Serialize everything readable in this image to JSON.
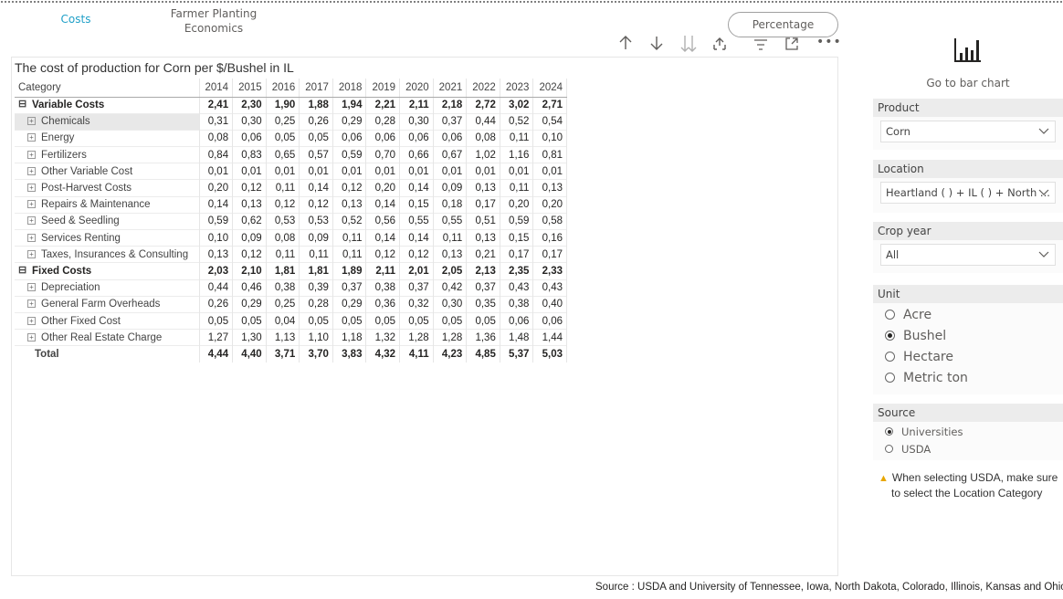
{
  "nav": {
    "costs_label": "Costs",
    "farmer_label_line1": "Farmer Planting",
    "farmer_label_line2": "Economics",
    "percentage_button": "Percentage"
  },
  "toolbar": {
    "icons": [
      "arrow-up-icon",
      "arrow-down-icon",
      "double-arrow-down-icon",
      "expand-hierarchy-icon",
      "filter-icon",
      "focus-mode-icon",
      "more-options-icon"
    ]
  },
  "matrix": {
    "title": "The cost of production for Corn per $/Bushel in IL",
    "category_header": "Category",
    "years": [
      "2014",
      "2015",
      "2016",
      "2017",
      "2018",
      "2019",
      "2020",
      "2021",
      "2022",
      "2023",
      "2024"
    ],
    "rows": [
      {
        "label": "Variable Costs",
        "level": "group",
        "values": [
          "2,41",
          "2,30",
          "1,90",
          "1,88",
          "1,94",
          "2,21",
          "2,11",
          "2,18",
          "2,72",
          "3,02",
          "2,71"
        ]
      },
      {
        "label": "Chemicals",
        "level": "child",
        "values": [
          "0,31",
          "0,30",
          "0,25",
          "0,26",
          "0,29",
          "0,28",
          "0,30",
          "0,37",
          "0,44",
          "0,52",
          "0,54"
        ]
      },
      {
        "label": "Energy",
        "level": "child",
        "values": [
          "0,08",
          "0,06",
          "0,05",
          "0,05",
          "0,06",
          "0,06",
          "0,06",
          "0,06",
          "0,08",
          "0,11",
          "0,10"
        ]
      },
      {
        "label": "Fertilizers",
        "level": "child",
        "values": [
          "0,84",
          "0,83",
          "0,65",
          "0,57",
          "0,59",
          "0,70",
          "0,66",
          "0,67",
          "1,02",
          "1,16",
          "0,81"
        ]
      },
      {
        "label": "Other Variable Cost",
        "level": "child",
        "values": [
          "0,01",
          "0,01",
          "0,01",
          "0,01",
          "0,01",
          "0,01",
          "0,01",
          "0,01",
          "0,01",
          "0,01",
          "0,01"
        ]
      },
      {
        "label": "Post-Harvest Costs",
        "level": "child",
        "values": [
          "0,20",
          "0,12",
          "0,11",
          "0,14",
          "0,12",
          "0,20",
          "0,14",
          "0,09",
          "0,13",
          "0,11",
          "0,13"
        ]
      },
      {
        "label": "Repairs & Maintenance",
        "level": "child",
        "values": [
          "0,14",
          "0,13",
          "0,12",
          "0,12",
          "0,13",
          "0,14",
          "0,15",
          "0,18",
          "0,17",
          "0,20",
          "0,20"
        ]
      },
      {
        "label": "Seed & Seedling",
        "level": "child",
        "values": [
          "0,59",
          "0,62",
          "0,53",
          "0,53",
          "0,52",
          "0,56",
          "0,55",
          "0,55",
          "0,51",
          "0,59",
          "0,58"
        ]
      },
      {
        "label": "Services Renting",
        "level": "child",
        "values": [
          "0,10",
          "0,09",
          "0,08",
          "0,09",
          "0,11",
          "0,14",
          "0,14",
          "0,11",
          "0,13",
          "0,15",
          "0,16"
        ]
      },
      {
        "label": "Taxes, Insurances & Consulting",
        "level": "child",
        "values": [
          "0,13",
          "0,12",
          "0,11",
          "0,11",
          "0,11",
          "0,12",
          "0,12",
          "0,13",
          "0,21",
          "0,17",
          "0,17"
        ]
      },
      {
        "label": "Fixed Costs",
        "level": "group",
        "values": [
          "2,03",
          "2,10",
          "1,81",
          "1,81",
          "1,89",
          "2,11",
          "2,01",
          "2,05",
          "2,13",
          "2,35",
          "2,33"
        ]
      },
      {
        "label": "Depreciation",
        "level": "child",
        "values": [
          "0,44",
          "0,46",
          "0,38",
          "0,39",
          "0,37",
          "0,38",
          "0,37",
          "0,42",
          "0,37",
          "0,43",
          "0,43"
        ]
      },
      {
        "label": "General Farm Overheads",
        "level": "child",
        "values": [
          "0,26",
          "0,29",
          "0,25",
          "0,28",
          "0,29",
          "0,36",
          "0,32",
          "0,30",
          "0,35",
          "0,38",
          "0,40"
        ]
      },
      {
        "label": "Other Fixed Cost",
        "level": "child",
        "values": [
          "0,05",
          "0,05",
          "0,04",
          "0,05",
          "0,05",
          "0,05",
          "0,05",
          "0,05",
          "0,05",
          "0,06",
          "0,06"
        ]
      },
      {
        "label": "Other Real Estate Charge",
        "level": "child",
        "values": [
          "1,27",
          "1,30",
          "1,13",
          "1,10",
          "1,18",
          "1,32",
          "1,28",
          "1,28",
          "1,36",
          "1,48",
          "1,44"
        ]
      },
      {
        "label": "Total",
        "level": "total",
        "values": [
          "4,44",
          "4,40",
          "3,71",
          "3,70",
          "3,83",
          "4,32",
          "4,11",
          "4,23",
          "4,85",
          "5,37",
          "5,03"
        ]
      }
    ],
    "selected_row": "Chemicals"
  },
  "goto_bar": {
    "label": "Go to bar chart",
    "icon": "bar-chart-icon"
  },
  "slicers": {
    "product": {
      "title": "Product",
      "value": "Corn"
    },
    "location": {
      "title": "Location",
      "value": "Heartland ( ) + IL ( ) + North ..."
    },
    "crop_year": {
      "title": "Crop year",
      "value": "All"
    },
    "unit": {
      "title": "Unit",
      "options": [
        "Acre",
        "Bushel",
        "Hectare",
        "Metric ton"
      ],
      "selected": "Bushel"
    },
    "source": {
      "title": "Source",
      "options": [
        "Universities",
        "USDA"
      ],
      "selected": "Universities"
    }
  },
  "warning": {
    "line1": "When selecting USDA, make sure",
    "line2": "to select the Location Category"
  },
  "source_note": "Source : USDA and University of Tennessee, Iowa, North Dakota, Colorado, Illinois, Kansas and Ohio"
}
